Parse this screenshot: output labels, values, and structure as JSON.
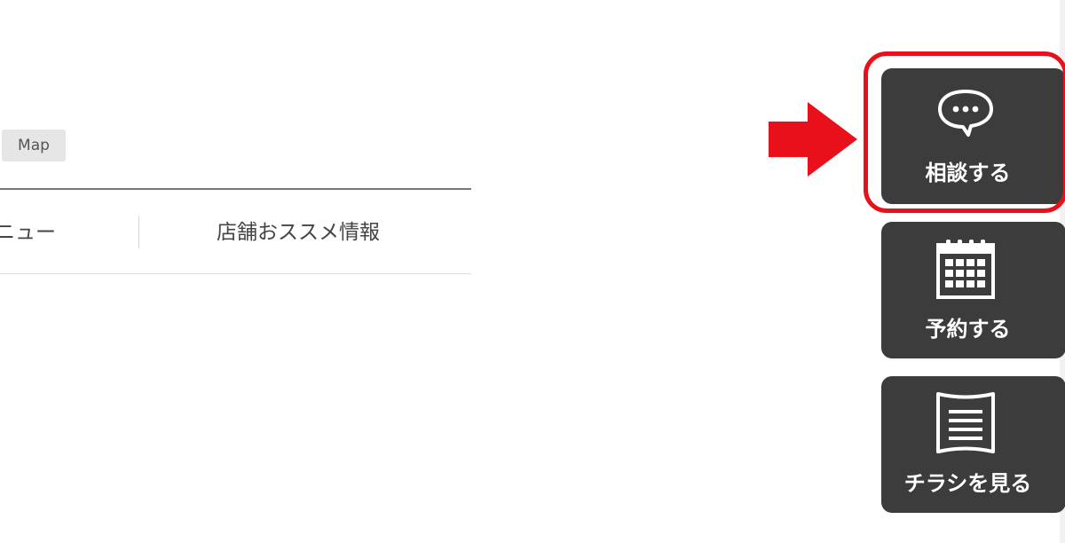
{
  "map_badge": {
    "label": "Map"
  },
  "tabs": [
    {
      "label": "ニュー"
    },
    {
      "label": "店舗おススメ情報"
    }
  ],
  "side_buttons": {
    "consult": {
      "label": "相談する",
      "icon": "chat-bubble-icon"
    },
    "reserve": {
      "label": "予約する",
      "icon": "calendar-icon"
    },
    "flyer": {
      "label": "チラシを見る",
      "icon": "flyer-document-icon"
    }
  },
  "colors": {
    "button_bg": "#3c3c3c",
    "highlight": "#e8101a",
    "arrow": "#e8101a"
  }
}
